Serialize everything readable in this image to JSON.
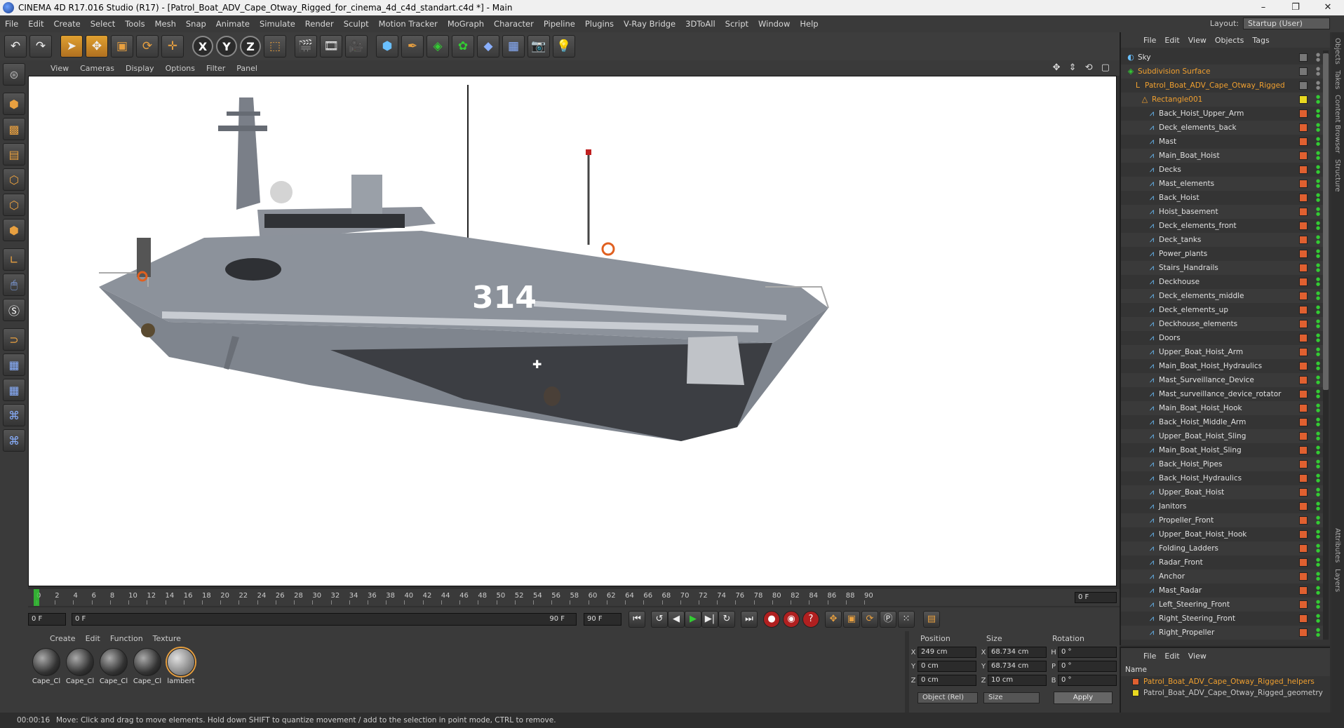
{
  "window": {
    "title": "CINEMA 4D R17.016 Studio (R17) - [Patrol_Boat_ADV_Cape_Otway_Rigged_for_cinema_4d_c4d_standart.c4d *] - Main",
    "minimize": "–",
    "maximize": "❐",
    "close": "✕"
  },
  "menu": [
    "File",
    "Edit",
    "Create",
    "Select",
    "Tools",
    "Mesh",
    "Snap",
    "Animate",
    "Simulate",
    "Render",
    "Sculpt",
    "Motion Tracker",
    "MoGraph",
    "Character",
    "Pipeline",
    "Plugins",
    "V-Ray Bridge",
    "3DToAll",
    "Script",
    "Window",
    "Help"
  ],
  "layout": {
    "label": "Layout:",
    "value": "Startup (User)"
  },
  "toolbar": {
    "x": "X",
    "y": "Y",
    "z": "Z"
  },
  "viewport_menu": [
    "View",
    "Cameras",
    "Display",
    "Options",
    "Filter",
    "Panel"
  ],
  "viewport_nav": "✥ ⇕ ⟲ ▢",
  "scene": {
    "hull_number": "314"
  },
  "timeline": {
    "ticks": [
      "0",
      "2",
      "4",
      "6",
      "8",
      "10",
      "12",
      "14",
      "16",
      "18",
      "20",
      "22",
      "24",
      "26",
      "28",
      "30",
      "32",
      "34",
      "36",
      "38",
      "40",
      "42",
      "44",
      "46",
      "48",
      "50",
      "52",
      "54",
      "56",
      "58",
      "60",
      "62",
      "64",
      "66",
      "68",
      "70",
      "72",
      "74",
      "76",
      "78",
      "80",
      "82",
      "84",
      "86",
      "88",
      "90"
    ],
    "current_frame": "0 F"
  },
  "playback": {
    "start": "0 F",
    "range_start": "0 F",
    "range_end": "90 F",
    "end": "90 F"
  },
  "materials": {
    "menu": [
      "Create",
      "Edit",
      "Function",
      "Texture"
    ],
    "items": [
      {
        "label": "Cape_Cl"
      },
      {
        "label": "Cape_Cl"
      },
      {
        "label": "Cape_Cl"
      },
      {
        "label": "Cape_Cl"
      },
      {
        "label": "lambert"
      }
    ]
  },
  "coords": {
    "headers": {
      "position": "Position",
      "size": "Size",
      "rotation": "Rotation"
    },
    "rows": [
      {
        "axis": "X",
        "pos": "249 cm",
        "size_axis": "X",
        "size": "68.734 cm",
        "rot_axis": "H",
        "rot": "0 °"
      },
      {
        "axis": "Y",
        "pos": "0 cm",
        "size_axis": "Y",
        "size": "68.734 cm",
        "rot_axis": "P",
        "rot": "0 °"
      },
      {
        "axis": "Z",
        "pos": "0 cm",
        "size_axis": "Z",
        "size": "10 cm",
        "rot_axis": "B",
        "rot": "0 °"
      }
    ],
    "mode": "Object (Rel)",
    "size_mode": "Size",
    "apply": "Apply"
  },
  "status": {
    "time": "00:00:16",
    "message": "Move: Click and drag to move elements. Hold down SHIFT to quantize movement / add to the selection in point mode, CTRL to remove."
  },
  "object_manager": {
    "menu": [
      "File",
      "Edit",
      "View",
      "Objects",
      "Tags"
    ],
    "objects": [
      {
        "name": "Sky",
        "indent": 0
      },
      {
        "name": "Subdivision Surface",
        "indent": 0
      },
      {
        "name": "Patrol_Boat_ADV_Cape_Otway_Rigged",
        "indent": 1
      },
      {
        "name": "Rectangle001",
        "indent": 2
      },
      {
        "name": "Back_Hoist_Upper_Arm",
        "indent": 3
      },
      {
        "name": "Deck_elements_back",
        "indent": 3
      },
      {
        "name": "Mast",
        "indent": 3
      },
      {
        "name": "Main_Boat_Hoist",
        "indent": 3
      },
      {
        "name": "Decks",
        "indent": 3
      },
      {
        "name": "Mast_elements",
        "indent": 3
      },
      {
        "name": "Back_Hoist",
        "indent": 3
      },
      {
        "name": "Hoist_basement",
        "indent": 3
      },
      {
        "name": "Deck_elements_front",
        "indent": 3
      },
      {
        "name": "Deck_tanks",
        "indent": 3
      },
      {
        "name": "Power_plants",
        "indent": 3
      },
      {
        "name": "Stairs_Handrails",
        "indent": 3
      },
      {
        "name": "Deckhouse",
        "indent": 3
      },
      {
        "name": "Deck_elements_middle",
        "indent": 3
      },
      {
        "name": "Deck_elements_up",
        "indent": 3
      },
      {
        "name": "Deckhouse_elements",
        "indent": 3
      },
      {
        "name": "Doors",
        "indent": 3
      },
      {
        "name": "Upper_Boat_Hoist_Arm",
        "indent": 3
      },
      {
        "name": "Main_Boat_Hoist_Hydraulics",
        "indent": 3
      },
      {
        "name": "Mast_Surveillance_Device",
        "indent": 3
      },
      {
        "name": "Mast_surveillance_device_rotator",
        "indent": 3
      },
      {
        "name": "Main_Boat_Hoist_Hook",
        "indent": 3
      },
      {
        "name": "Back_Hoist_Middle_Arm",
        "indent": 3
      },
      {
        "name": "Upper_Boat_Hoist_Sling",
        "indent": 3
      },
      {
        "name": "Main_Boat_Hoist_Sling",
        "indent": 3
      },
      {
        "name": "Back_Hoist_Pipes",
        "indent": 3
      },
      {
        "name": "Back_Hoist_Hydraulics",
        "indent": 3
      },
      {
        "name": "Upper_Boat_Hoist",
        "indent": 3
      },
      {
        "name": "Janitors",
        "indent": 3
      },
      {
        "name": "Propeller_Front",
        "indent": 3
      },
      {
        "name": "Upper_Boat_Hoist_Hook",
        "indent": 3
      },
      {
        "name": "Folding_Ladders",
        "indent": 3
      },
      {
        "name": "Radar_Front",
        "indent": 3
      },
      {
        "name": "Anchor",
        "indent": 3
      },
      {
        "name": "Mast_Radar",
        "indent": 3
      },
      {
        "name": "Left_Steering_Front",
        "indent": 3
      },
      {
        "name": "Right_Steering_Front",
        "indent": 3
      },
      {
        "name": "Right_Propeller",
        "indent": 3
      }
    ]
  },
  "layer_manager": {
    "menu": [
      "File",
      "Edit",
      "View"
    ],
    "header": "Name",
    "layers": [
      {
        "name": "Patrol_Boat_ADV_Cape_Otway_Rigged_helpers",
        "color": "#e06030"
      },
      {
        "name": "Patrol_Boat_ADV_Cape_Otway_Rigged_geometry",
        "color": "#e8d820"
      }
    ]
  },
  "right_tabs": [
    "Objects",
    "Takes",
    "Content Browser",
    "Structure",
    "Attributes",
    "Layers"
  ],
  "colors": {
    "accent": "#e8a040",
    "selected_text": "#f0a030"
  }
}
